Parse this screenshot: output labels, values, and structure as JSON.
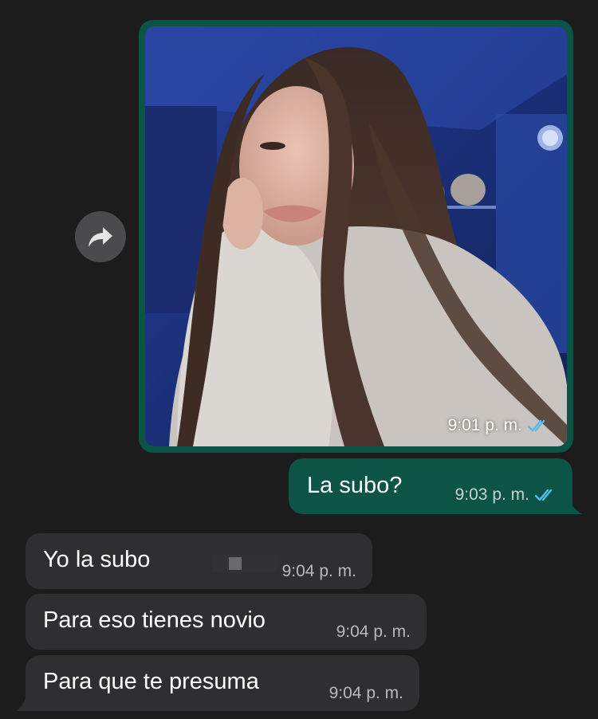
{
  "conversation": {
    "image_message": {
      "time": "9:01 p. m.",
      "status_icon": "double-check-read-icon"
    },
    "outgoing_text": {
      "text": "La subo?",
      "time": "9:03 p. m.",
      "status_icon": "double-check-read-icon"
    },
    "incoming": [
      {
        "text": "Yo la subo",
        "time": "9:04 p. m."
      },
      {
        "text": "Para eso tienes novio",
        "time": "9:04 p. m."
      },
      {
        "text": "Para que te presuma",
        "time": "9:04 p. m."
      }
    ],
    "forward_icon": "forward-arrow-icon"
  },
  "colors": {
    "background": "#1c1c1c",
    "outgoing_bubble": "#0c5446",
    "incoming_bubble": "#2f2f31",
    "read_ticks": "#53bdeb"
  }
}
